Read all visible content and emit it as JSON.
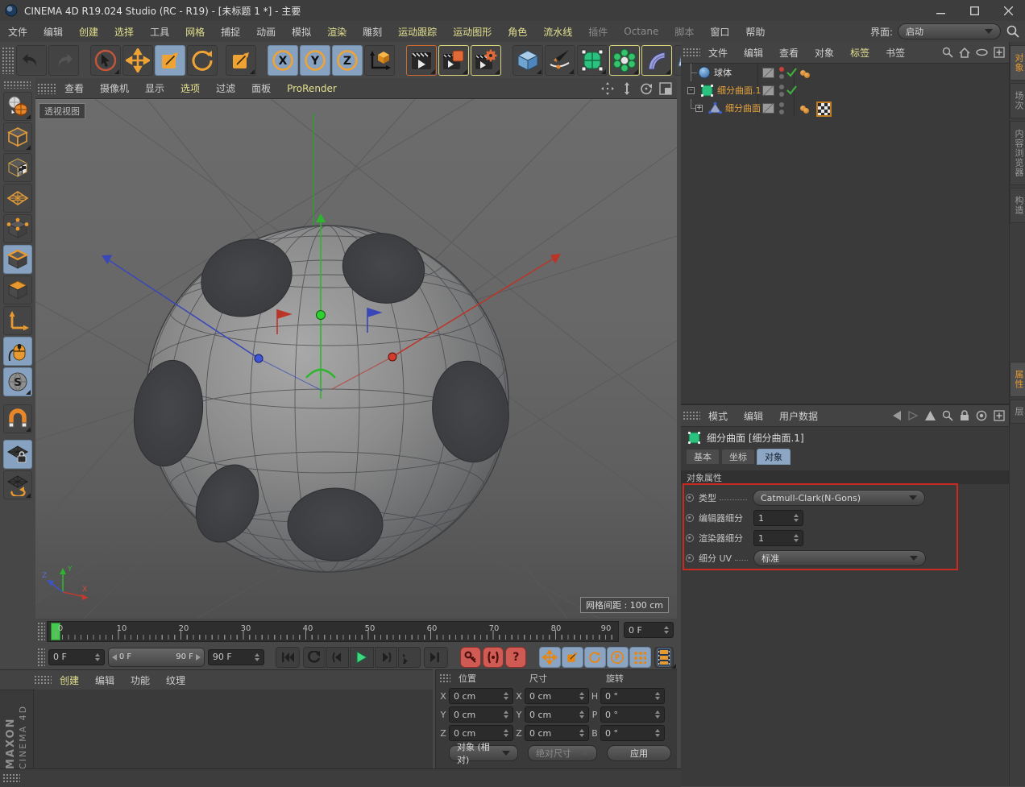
{
  "window": {
    "title": "CINEMA 4D R19.024 Studio (RC - R19) - [未标题 1 *] - 主要"
  },
  "menubar": {
    "items": [
      "文件",
      "编辑",
      "创建",
      "选择",
      "工具",
      "网格",
      "捕捉",
      "动画",
      "模拟",
      "渲染",
      "雕刻",
      "运动跟踪",
      "运动图形",
      "角色",
      "流水线",
      "插件",
      "Octane",
      "脚本",
      "窗口",
      "帮助"
    ],
    "interface_label": "界面:",
    "interface_value": "启动"
  },
  "toolbar_icons": [
    "undo",
    "redo",
    "live-selection",
    "move",
    "scale",
    "rotate",
    "last-tool-scale",
    "x-axis-lock",
    "y-axis-lock",
    "z-axis-lock",
    "coordinate-system",
    "render-view",
    "render-to-picture-viewer",
    "edit-render-settings",
    "add-cube-primitive",
    "add-spline-pen",
    "add-subdivision-surface",
    "add-mograph-cloner",
    "add-bend-deformer",
    "add-floor",
    "add-camera",
    "add-light"
  ],
  "mode_palette_icons": [
    "make-editable",
    "model-mode",
    "texture-mode",
    "workplane-mode",
    "points-mode",
    "edges-mode",
    "polygons-mode",
    "enable-axis",
    "tweak-mode",
    "viewport-solo",
    "enable-snap",
    "lock-workplane",
    "workplane-tool"
  ],
  "viewport": {
    "menu": [
      "查看",
      "摄像机",
      "显示",
      "选项",
      "过滤",
      "面板",
      "ProRender"
    ],
    "nav_icons": [
      "pan-view",
      "zoom-view",
      "rotate-view",
      "toggle-view"
    ],
    "view_label": "透视视图",
    "grid_label": "网格间距 : 100 cm"
  },
  "object_manager": {
    "menu": [
      "文件",
      "编辑",
      "查看",
      "对象",
      "标签",
      "书签"
    ],
    "header_icons": [
      "search",
      "home",
      "path",
      "add-panel"
    ],
    "objects": [
      {
        "name": "球体",
        "icon": "sphere-object",
        "editor_dot": "red",
        "render_dot": "gray",
        "enabled": true,
        "tags": [
          "phong-tag"
        ]
      },
      {
        "name": "细分曲面.1",
        "icon": "subdivision-surface-object",
        "editor_dot": "gray",
        "render_dot": "gray",
        "enabled": true,
        "tags": []
      },
      {
        "name": "细分曲面",
        "icon": "polygon-object",
        "editor_dot": "gray",
        "render_dot": "gray",
        "enabled": null,
        "tags": [
          "phong-tag",
          "uvw-tag"
        ]
      }
    ]
  },
  "right_tabs": {
    "top": [
      "对象",
      "场次",
      "内容浏览器",
      "构造"
    ],
    "top_active": "对象",
    "bottom": [
      "属性",
      "层"
    ],
    "bottom_active": "属性"
  },
  "attribute_manager": {
    "menu": [
      "模式",
      "编辑",
      "用户数据"
    ],
    "header_icons": [
      "back",
      "forward",
      "up",
      "search",
      "lock",
      "target",
      "add-panel"
    ],
    "object_title": "细分曲面 [细分曲面.1]",
    "tabs": [
      "基本",
      "坐标",
      "对象"
    ],
    "active_tab": "对象",
    "section_title": "对象属性",
    "fields": [
      {
        "label": "类型",
        "value": "Catmull-Clark(N-Gons)",
        "control": "dropdown"
      },
      {
        "label": "编辑器细分",
        "value": "1",
        "control": "spinner"
      },
      {
        "label": "渲染器细分",
        "value": "1",
        "control": "spinner"
      },
      {
        "label": "细分 UV",
        "value": "标准",
        "control": "dropdown"
      }
    ]
  },
  "timeline": {
    "ticks": [
      "0",
      "10",
      "20",
      "30",
      "40",
      "50",
      "60",
      "70",
      "80",
      "90"
    ],
    "current_frame": "0 F",
    "range_start": "0 F",
    "range_end": "90 F",
    "end_frame": "90 F",
    "transport_icons": [
      "go-to-start",
      "play-backwards",
      "previous-frame",
      "play-forwards",
      "next-frame",
      "play-cycle",
      "go-to-end",
      "record-keyframe",
      "autokeying",
      "keyframe-selection",
      "record-position",
      "record-scale",
      "record-rotation",
      "record-parameter",
      "record-point-level",
      "timeline-window"
    ]
  },
  "material_manager": {
    "menu": [
      "创建",
      "编辑",
      "功能",
      "纹理"
    ],
    "logo_line1": "MAXON",
    "logo_line2": "CINEMA 4D"
  },
  "coordinates": {
    "headers": [
      "位置",
      "尺寸",
      "旋转"
    ],
    "pos_labels": [
      "X",
      "Y",
      "Z"
    ],
    "size_labels": [
      "X",
      "Y",
      "Z"
    ],
    "rot_labels": [
      "H",
      "P",
      "B"
    ],
    "pos_values": [
      "0 cm",
      "0 cm",
      "0 cm"
    ],
    "size_values": [
      "0 cm",
      "0 cm",
      "0 cm"
    ],
    "rot_values": [
      "0 °",
      "0 °",
      "0 °"
    ],
    "mode": "对象 (相对)",
    "size_mode": "绝对尺寸",
    "apply_label": "应用"
  },
  "colors": {
    "accent_orange": "#eb9b2d",
    "highlight_yellow": "#e3e08f",
    "active_blue": "#87a1c0",
    "annotation_red": "#cc2a20",
    "axis_green": "#2db52d",
    "axis_red": "#c03a2e",
    "axis_blue": "#3c54c6"
  }
}
